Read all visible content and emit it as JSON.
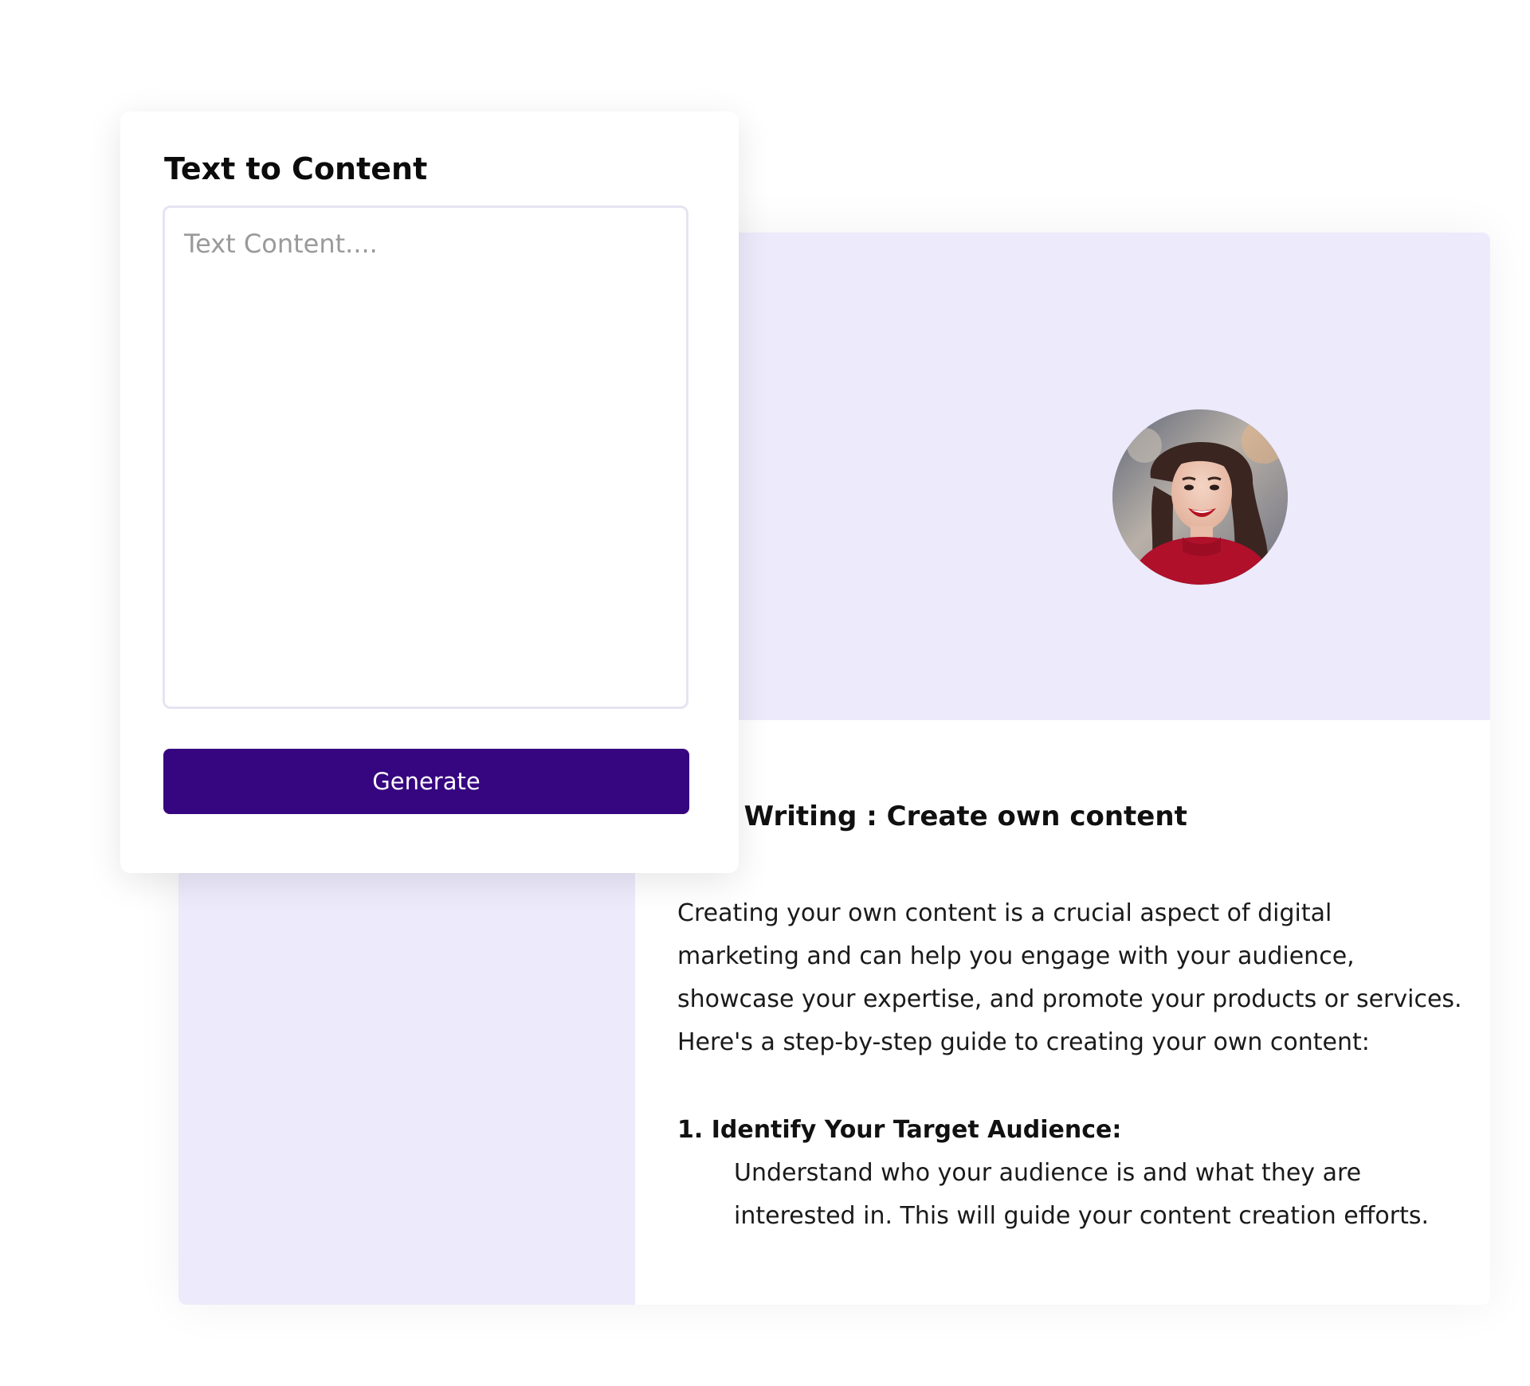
{
  "input_panel": {
    "title": "Text to Content",
    "textarea_placeholder": "Text Content....",
    "generate_label": "Generate"
  },
  "result": {
    "heading": "tent Writing : Create own content",
    "intro_lines": [
      "Creating your own content is a crucial aspect of digital",
      "marketing and can help you engage with your audience,",
      "showcase your expertise, and promote your products or services.",
      "Here's a step-by-step guide to creating your own content:"
    ],
    "step_1": {
      "title": "1. Identify Your Target Audience:",
      "lines": [
        "Understand who your audience is and what they are",
        "interested in. This will guide your content creation efforts."
      ]
    },
    "avatar": {
      "icon": "smiling-woman-avatar"
    }
  },
  "colors": {
    "accent": "#360580",
    "lavender": "#eceafb",
    "border": "#e6e4f2"
  }
}
